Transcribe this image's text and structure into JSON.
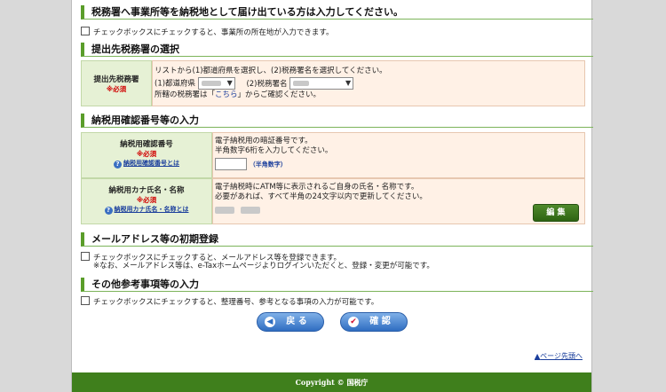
{
  "sections": {
    "tax_office_register": {
      "title": "税務署へ事業所等を納税地として届け出ている方は入力してください。",
      "checkbox_label": "チェックボックスにチェックすると、事業所の所在地が入力できます。"
    },
    "office_select": {
      "title": "提出先税務署の選択",
      "label": "提出先税務署",
      "required": "※必須",
      "instruction": "リストから(1)都道府県を選択し、(2)税務署名を選択してください。",
      "prefecture_label": "(1)都道府県",
      "office_label": "(2)税務署名",
      "jurisdiction_before": "所轄の税務署は「",
      "jurisdiction_link": "こちら",
      "jurisdiction_after": "」からご確認ください。"
    },
    "confirmation": {
      "title": "納税用確認番号等の入力",
      "pin_label": "納税用確認番号",
      "pin_required": "※必須",
      "pin_help": "納税用確認番号とは",
      "pin_desc1": "電子納税用の暗証番号です。",
      "pin_desc2": "半角数字6桁を入力してください。",
      "pin_hint": "（半角数字）",
      "kana_label": "納税用カナ氏名・名称",
      "kana_required": "※必須",
      "kana_help": "納税用カナ氏名・名称とは",
      "kana_desc1": "電子納税時にATM等に表示されるご自身の氏名・名称です。",
      "kana_desc2": "必要があれば、すべて半角の24文字以内で更新してください。",
      "edit_label": "編 集"
    },
    "mail": {
      "title": "メールアドレス等の初期登録",
      "checkbox_label": "チェックボックスにチェックすると、メールアドレス等を登録できます。",
      "note": "※なお、メールアドレス等は、e-Taxホームページよりログインいただくと、登録・変更が可能です。"
    },
    "other": {
      "title": "その他参考事項等の入力",
      "checkbox_label": "チェックボックスにチェックすると、整理番号、参考となる事項の入力が可能です。"
    }
  },
  "buttons": {
    "back": "戻 る",
    "confirm": "確 認"
  },
  "page_top": "ページ先頭へ",
  "footer": "Copyright © 国税庁"
}
